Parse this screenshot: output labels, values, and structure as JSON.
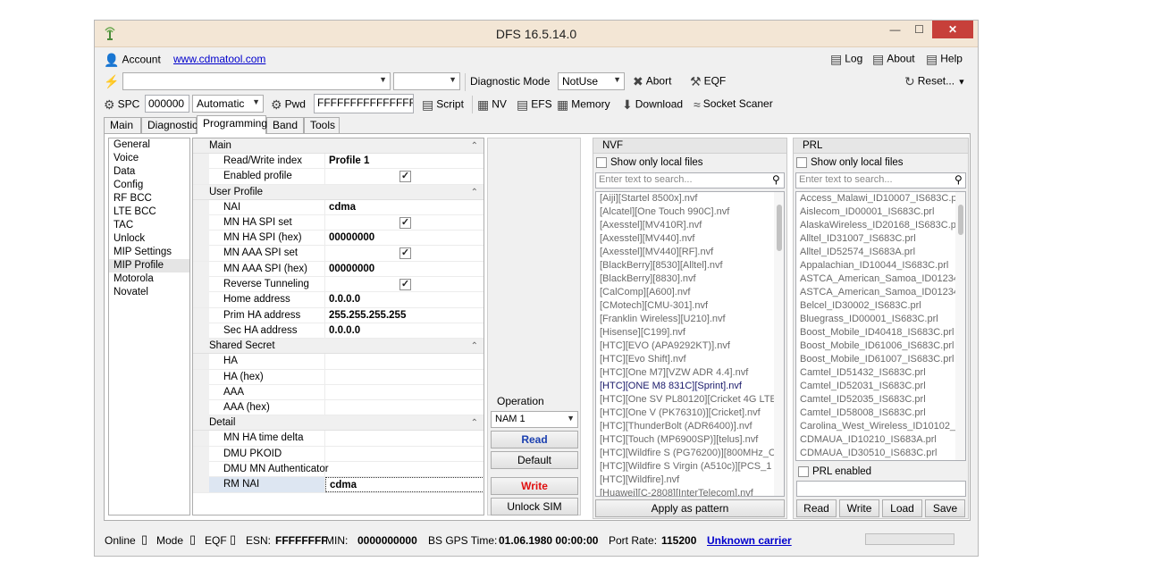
{
  "window": {
    "title": "DFS 16.5.14.0"
  },
  "row1": {
    "account": "Account",
    "url": "www.cdmatool.com",
    "log": "Log",
    "about": "About",
    "help": "Help"
  },
  "row2": {
    "diagnostic_mode_label": "Diagnostic Mode",
    "diagnostic_mode_value": "NotUse",
    "abort": "Abort",
    "eqf": "EQF",
    "reset": "Reset..."
  },
  "row3": {
    "spc_label": "SPC",
    "spc_value": "000000",
    "spc_mode": "Automatic",
    "pwd_label": "Pwd",
    "pwd_value": "FFFFFFFFFFFFFFFF",
    "script": "Script",
    "nv": "NV",
    "efs": "EFS",
    "memory": "Memory",
    "download": "Download",
    "socket": "Socket Scaner"
  },
  "tabs": [
    "Main",
    "Diagnostic",
    "Programming",
    "Band",
    "Tools"
  ],
  "active_tab": "Programming",
  "left_list": [
    "General",
    "Voice",
    "Data",
    "Config",
    "RF BCC",
    "LTE BCC",
    "TAC",
    "Unlock",
    "MIP Settings",
    "MIP Profile",
    "Motorola",
    "Novatel"
  ],
  "selected_left": "MIP Profile",
  "grid": {
    "main": {
      "title": "Main",
      "rw_index_label": "Read/Write index",
      "rw_index_value": "Profile 1",
      "enabled_label": "Enabled profile"
    },
    "user": {
      "title": "User Profile",
      "nai_label": "NAI",
      "nai_value": "cdma",
      "mnha_set": "MN HA SPI set",
      "mnha_hex": "MN HA SPI (hex)",
      "mnha_hex_value": "00000000",
      "mnaaa_set": "MN AAA SPI set",
      "mnaaa_hex": "MN AAA SPI (hex)",
      "mnaaa_hex_value": "00000000",
      "rev_tun": "Reverse Tunneling",
      "home_addr": "Home address",
      "home_addr_value": "0.0.0.0",
      "prim_ha": "Prim HA address",
      "prim_ha_value": "255.255.255.255",
      "sec_ha": "Sec HA address",
      "sec_ha_value": "0.0.0.0"
    },
    "shared": {
      "title": "Shared Secret",
      "ha": "HA",
      "ha_hex": "HA (hex)",
      "aaa": "AAA",
      "aaa_hex": "AAA (hex)"
    },
    "detail": {
      "title": "Detail",
      "mnha_time": "MN HA time delta",
      "dmu_pkoid": "DMU PKOID",
      "dmu_mn": "DMU MN Authenticator",
      "rm_nai": "RM NAI",
      "rm_nai_value": "cdma"
    }
  },
  "operation": {
    "title": "Operation",
    "nam": "NAM 1",
    "read": "Read",
    "default": "Default",
    "write": "Write",
    "unlock": "Unlock SIM"
  },
  "nvf": {
    "title": "NVF",
    "show_local": "Show only local files",
    "search_placeholder": "Enter text to search...",
    "files": [
      "[Aiji][Startel 8500x].nvf",
      "[Alcatel][One Touch 990C].nvf",
      "[Axesstel][MV410R].nvf",
      "[Axesstel][MV440].nvf",
      "[Axesstel][MV440][RF].nvf",
      "[BlackBerry][8530][Alltel].nvf",
      "[BlackBerry][8830].nvf",
      "[CalComp][A600].nvf",
      "[CMotech][CMU-301].nvf",
      "[Franklin Wireless][U210].nvf",
      "[Hisense][C199].nvf",
      "[HTC][EVO (APA9292KT)].nvf",
      "[HTC][Evo Shift].nvf",
      "[HTC][One M7][VZW ADR 4.4].nvf",
      "[HTC][ONE M8 831C][Sprint].nvf",
      "[HTC][One SV PL80120][Cricket 4G LTE",
      "[HTC][One V (PK76310)][Cricket].nvf",
      "[HTC][ThunderBolt (ADR6400)].nvf",
      "[HTC][Touch (MP6900SP)][telus].nvf",
      "[HTC][Wildfire S (PG76200)][800MHz_C",
      "[HTC][Wildfire S Virgin (A510c)][PCS_1",
      "[HTC][Wildfire].nvf",
      "[Huawei][C-2808][InterTelecom].nvf"
    ],
    "highlighted": "[HTC][ONE M8 831C][Sprint].nvf",
    "apply": "Apply as pattern"
  },
  "prl": {
    "title": "PRL",
    "show_local": "Show only local files",
    "search_placeholder": "Enter text to search...",
    "files": [
      "Access_Malawi_ID10007_IS683C.p",
      "Aislecom_ID00001_IS683C.prl",
      "AlaskaWireless_ID20168_IS683C.p",
      "Alltel_ID31007_IS683C.prl",
      "Alltel_ID52574_IS683A.prl",
      "Appalachian_ID10044_IS683C.prl",
      "ASTCA_American_Samoa_ID01234",
      "ASTCA_American_Samoa_ID01234",
      "Belcel_ID30002_IS683C.prl",
      "Bluegrass_ID00001_IS683C.prl",
      "Boost_Mobile_ID40418_IS683C.prl",
      "Boost_Mobile_ID61006_IS683C.prl",
      "Boost_Mobile_ID61007_IS683C.prl",
      "Camtel_ID51432_IS683C.prl",
      "Camtel_ID52031_IS683C.prl",
      "Camtel_ID52035_IS683C.prl",
      "Camtel_ID58008_IS683C.prl",
      "Carolina_West_Wireless_ID10102_",
      "CDMAUA_ID10210_IS683A.prl",
      "CDMAUA_ID30510_IS683C.prl"
    ],
    "prl_enabled": "PRL enabled",
    "read": "Read",
    "write": "Write",
    "load": "Load",
    "save": "Save"
  },
  "status": {
    "online": "Online",
    "mode": "Mode",
    "eqf": "EQF",
    "esn_label": "ESN:",
    "esn_value": "FFFFFFFF",
    "min_label": "MIN:",
    "min_value": "0000000000",
    "gps_label": "BS GPS Time:",
    "gps_value": "01.06.1980 00:00:00",
    "port_label": "Port Rate:",
    "port_value": "115200",
    "carrier": "Unknown carrier"
  },
  "colors": {
    "title_bg": "#f3e6d5",
    "close_btn": "#c7403a",
    "read_text": "#1a3fb0",
    "write_text": "#e01010",
    "link": "#0000cc"
  }
}
